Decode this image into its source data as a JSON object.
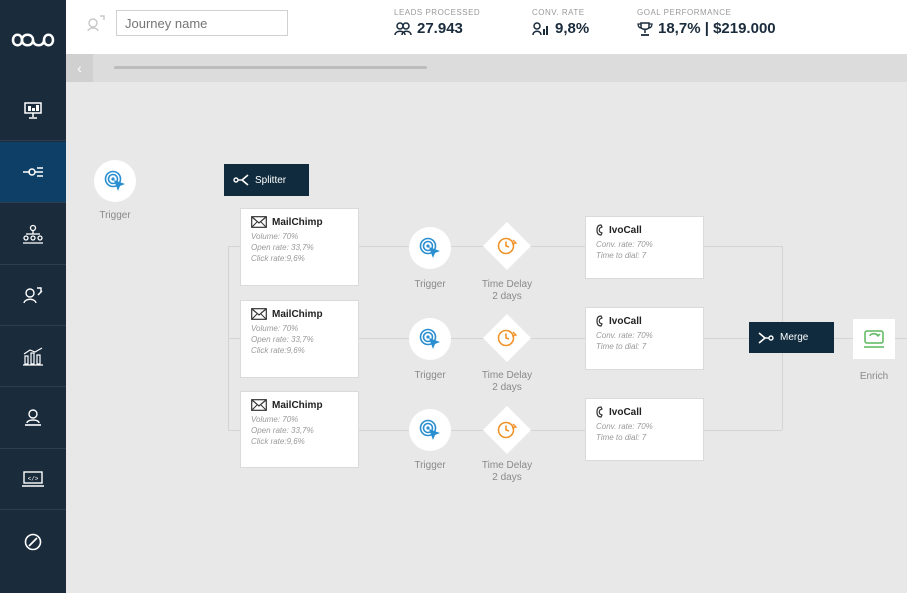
{
  "topbar": {
    "journey_name_placeholder": "Journey name",
    "kpis": [
      {
        "label": "LEADS PROCESSED",
        "value": "27.943",
        "icon": "users-icon"
      },
      {
        "label": "CONV. RATE",
        "value": "9,8%",
        "icon": "conversion-icon"
      },
      {
        "label": "GOAL PERFORMANCE",
        "value": "18,7% | $219.000",
        "icon": "trophy-icon"
      }
    ]
  },
  "sidebar": {
    "items": [
      "logo",
      "dashboard",
      "journeys",
      "audience",
      "leads",
      "analytics",
      "users",
      "developer",
      "settings"
    ],
    "active": "journeys"
  },
  "canvas": {
    "trigger_start_label": "Trigger",
    "splitter_label": "Splitter",
    "branches": [
      {
        "channel": {
          "title": "MailChimp",
          "lines": [
            "Volume: 70%",
            "Open rate: 33,7%",
            "Click rate:9,6%"
          ]
        },
        "trigger_label": "Trigger",
        "delay_label": [
          "Time Delay",
          "2 days"
        ],
        "action": {
          "title": "IvoCall",
          "lines": [
            "Conv. rate: 70%",
            "Time to dial: 7"
          ]
        }
      },
      {
        "channel": {
          "title": "MailChimp",
          "lines": [
            "Volume: 70%",
            "Open rate: 33,7%",
            "Click rate:9,6%"
          ]
        },
        "trigger_label": "Trigger",
        "delay_label": [
          "Time Delay",
          "2 days"
        ],
        "action": {
          "title": "IvoCall",
          "lines": [
            "Conv. rate: 70%",
            "Time to dial: 7"
          ]
        }
      },
      {
        "channel": {
          "title": "MailChimp",
          "lines": [
            "Volume: 70%",
            "Open rate: 33,7%",
            "Click rate:9,6%"
          ]
        },
        "trigger_label": "Trigger",
        "delay_label": [
          "Time Delay",
          "2 days"
        ],
        "action": {
          "title": "IvoCall",
          "lines": [
            "Conv. rate: 70%",
            "Time to dial: 7"
          ]
        }
      }
    ],
    "merge_label": "Merge",
    "enrich_label": "Enrich"
  },
  "colors": {
    "sidebar_bg": "#1a2b3c",
    "sidebar_active": "#0e3f66",
    "trigger_blue": "#2a8fd0",
    "delay_orange": "#f0932b",
    "enrich_green": "#5cb85c",
    "dark_button": "#0f2b3d"
  }
}
